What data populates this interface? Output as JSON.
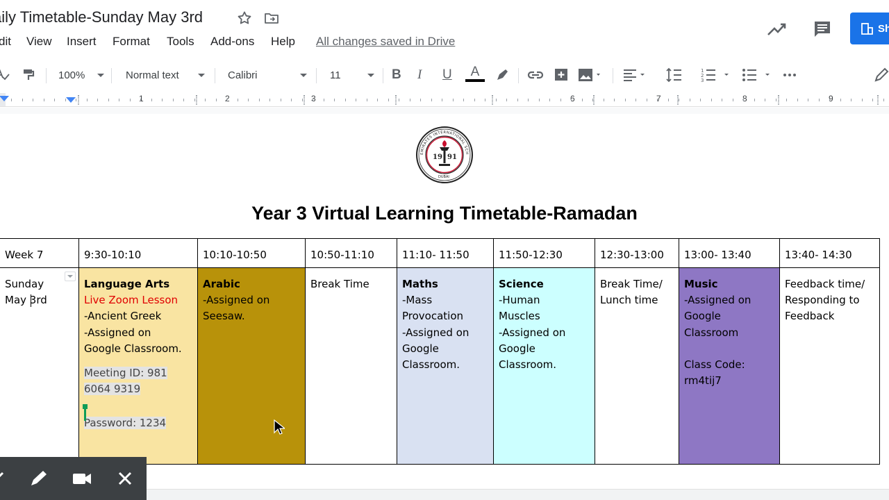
{
  "doc": {
    "title": "aily Timetable-Sunday May 3rd"
  },
  "menu": {
    "items": [
      "dit",
      "View",
      "Insert",
      "Format",
      "Tools",
      "Add-ons",
      "Help"
    ],
    "saved_status": "All changes saved in Drive"
  },
  "share": {
    "label": "Sh"
  },
  "toolbar": {
    "zoom": "100%",
    "style": "Normal text",
    "font": "Calibri",
    "size": "11",
    "icons": [
      "paint-format-icon",
      "bold-icon",
      "italic-icon",
      "underline-icon",
      "text-color-icon",
      "highlight-icon",
      "link-icon",
      "comment-add-icon",
      "image-icon",
      "align-icon",
      "line-spacing-icon",
      "numbered-list-icon",
      "bulleted-list-icon",
      "more-icon",
      "edit-mode-icon"
    ]
  },
  "ruler": {
    "numbers": [
      "1",
      "2",
      "3",
      "6",
      "7",
      "8",
      "9"
    ]
  },
  "heading": "Year 3 Virtual Learning Timetable-Ramadan",
  "table": {
    "headers": [
      "Week 7",
      "9:30-10:10",
      "10:10-10:50",
      "10:50-11:10",
      "11:10- 11:50",
      "11:50-12:30",
      "12:30-13:00",
      "13:00- 13:40",
      "13:40- 14:30"
    ],
    "day": {
      "line1": "Sunday",
      "line2": "May 3rd"
    },
    "language_arts": {
      "subject": "Language Arts",
      "live": "Live Zoom Lesson",
      "topic": "-Ancient Greek",
      "assigned_line1": "-Assigned on",
      "assigned_line2": "Google Classroom.",
      "meeting_line1": "Meeting ID: 981",
      "meeting_line2": "6064 9319",
      "password": "Password: 1234"
    },
    "arabic": {
      "subject": "Arabic",
      "line1": "-Assigned on",
      "line2": "Seesaw."
    },
    "break1": {
      "text": "Break Time"
    },
    "maths": {
      "subject": "Maths",
      "line1": "-Mass",
      "line2": "Provocation",
      "line3": "-Assigned on",
      "line4": "Google",
      "line5": "Classroom."
    },
    "science": {
      "subject": "Science",
      "line1": "-Human",
      "line2": "Muscles",
      "line3": "-Assigned on",
      "line4": "Google",
      "line5": "Classroom."
    },
    "break2": {
      "line1": "Break Time/",
      "line2": "Lunch time"
    },
    "music": {
      "subject": "Music",
      "line1": "-Assigned on",
      "line2": "Google",
      "line3": "Classroom",
      "code_line1": "Class Code:",
      "code_line2": "rm4tij7"
    },
    "feedback": {
      "line1": "Feedback time/",
      "line2": "Responding to",
      "line3": "Feedback"
    }
  },
  "colors": {
    "language_arts": "#f9e4a2",
    "arabic": "#b8920a",
    "maths": "#d9e1f2",
    "science": "#ccffff",
    "music": "#8e77c4",
    "accent": "#1a73e8"
  },
  "overlay": {
    "icons": [
      "pen-icon",
      "camera-icon",
      "close-icon"
    ]
  }
}
